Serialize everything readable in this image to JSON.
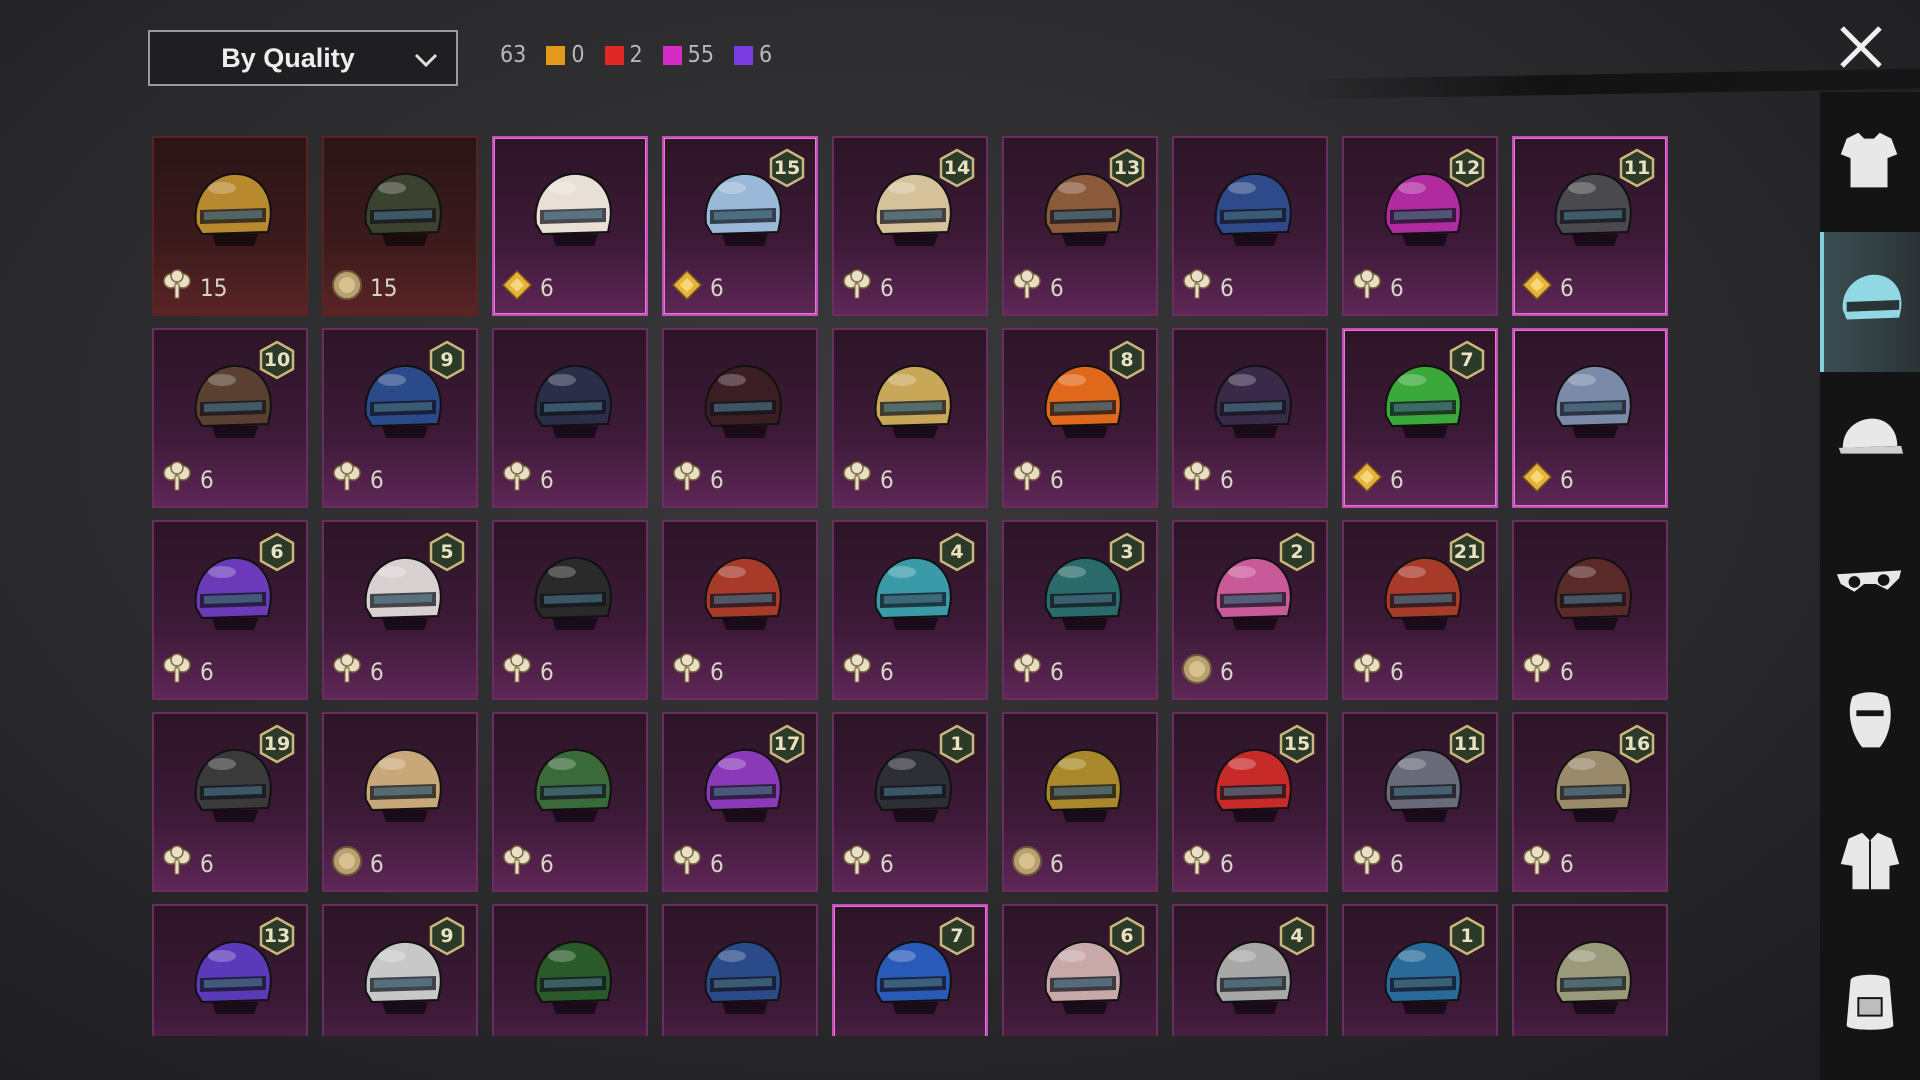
{
  "toolbar": {
    "sort_label": "By Quality",
    "total_count": "63",
    "counts": [
      {
        "color": "#e39a1c",
        "value": "0"
      },
      {
        "color": "#e02828",
        "value": "2"
      },
      {
        "color": "#d42cc4",
        "value": "55"
      },
      {
        "color": "#7a3ee0",
        "value": "6"
      }
    ],
    "close_icon": "close-icon"
  },
  "items": [
    {
      "level": "",
      "cost": "15",
      "currency": "clover",
      "rarity": "legendary",
      "color": "#b8892e"
    },
    {
      "level": "",
      "cost": "15",
      "currency": "coin",
      "rarity": "legendary",
      "color": "#3b4230"
    },
    {
      "level": "",
      "cost": "6",
      "currency": "diamond",
      "rarity": "mythic",
      "color": "#e8e0d6",
      "selected": true
    },
    {
      "level": "15",
      "cost": "6",
      "currency": "diamond",
      "rarity": "mythic",
      "color": "#9ab8d8",
      "selected": true
    },
    {
      "level": "14",
      "cost": "6",
      "currency": "clover",
      "rarity": "mythic",
      "color": "#d6c29a"
    },
    {
      "level": "13",
      "cost": "6",
      "currency": "clover",
      "rarity": "mythic",
      "color": "#8a5a3a"
    },
    {
      "level": "",
      "cost": "6",
      "currency": "clover",
      "rarity": "mythic",
      "color": "#2f4a8a"
    },
    {
      "level": "12",
      "cost": "6",
      "currency": "clover",
      "rarity": "mythic",
      "color": "#b02aa0"
    },
    {
      "level": "11",
      "cost": "6",
      "currency": "diamond",
      "rarity": "mythic",
      "color": "#4a4a4e",
      "selected": true
    },
    {
      "level": "10",
      "cost": "6",
      "currency": "clover",
      "rarity": "mythic",
      "color": "#5a4030"
    },
    {
      "level": "9",
      "cost": "6",
      "currency": "clover",
      "rarity": "mythic",
      "color": "#2a4a8a"
    },
    {
      "level": "",
      "cost": "6",
      "currency": "clover",
      "rarity": "mythic",
      "color": "#2a2e48"
    },
    {
      "level": "",
      "cost": "6",
      "currency": "clover",
      "rarity": "mythic",
      "color": "#3a1e24"
    },
    {
      "level": "",
      "cost": "6",
      "currency": "clover",
      "rarity": "mythic",
      "color": "#c8a858"
    },
    {
      "level": "8",
      "cost": "6",
      "currency": "clover",
      "rarity": "mythic",
      "color": "#e0681a"
    },
    {
      "level": "",
      "cost": "6",
      "currency": "clover",
      "rarity": "mythic",
      "color": "#3a2a4a"
    },
    {
      "level": "7",
      "cost": "6",
      "currency": "diamond",
      "rarity": "mythic",
      "color": "#3aa83a",
      "selected": true
    },
    {
      "level": "",
      "cost": "6",
      "currency": "diamond",
      "rarity": "mythic",
      "color": "#7a8aa8",
      "selected": true
    },
    {
      "level": "6",
      "cost": "6",
      "currency": "clover",
      "rarity": "mythic",
      "color": "#6a3ab8"
    },
    {
      "level": "5",
      "cost": "6",
      "currency": "clover",
      "rarity": "mythic",
      "color": "#d8d0d0"
    },
    {
      "level": "",
      "cost": "6",
      "currency": "clover",
      "rarity": "mythic",
      "color": "#2a2a2a"
    },
    {
      "level": "",
      "cost": "6",
      "currency": "clover",
      "rarity": "mythic",
      "color": "#a83a2a"
    },
    {
      "level": "4",
      "cost": "6",
      "currency": "clover",
      "rarity": "mythic",
      "color": "#3a9aa8"
    },
    {
      "level": "3",
      "cost": "6",
      "currency": "clover",
      "rarity": "mythic",
      "color": "#2a6a6a"
    },
    {
      "level": "2",
      "cost": "6",
      "currency": "coin",
      "rarity": "mythic",
      "color": "#c85a9a"
    },
    {
      "level": "21",
      "cost": "6",
      "currency": "clover",
      "rarity": "mythic",
      "color": "#a83a2a"
    },
    {
      "level": "",
      "cost": "6",
      "currency": "clover",
      "rarity": "mythic",
      "color": "#5a2a2a"
    },
    {
      "level": "19",
      "cost": "6",
      "currency": "clover",
      "rarity": "mythic",
      "color": "#3a3a3a"
    },
    {
      "level": "",
      "cost": "6",
      "currency": "coin",
      "rarity": "mythic",
      "color": "#c8a878"
    },
    {
      "level": "",
      "cost": "6",
      "currency": "clover",
      "rarity": "mythic",
      "color": "#3a6a3a"
    },
    {
      "level": "17",
      "cost": "6",
      "currency": "clover",
      "rarity": "mythic",
      "color": "#8a3ab8"
    },
    {
      "level": "1",
      "cost": "6",
      "currency": "clover",
      "rarity": "mythic",
      "color": "#2e2e36"
    },
    {
      "level": "",
      "cost": "6",
      "currency": "coin",
      "rarity": "mythic",
      "color": "#a8882a"
    },
    {
      "level": "15",
      "cost": "6",
      "currency": "clover",
      "rarity": "mythic",
      "color": "#c82a2a"
    },
    {
      "level": "11",
      "cost": "6",
      "currency": "clover",
      "rarity": "mythic",
      "color": "#6a6a7a"
    },
    {
      "level": "16",
      "cost": "6",
      "currency": "clover",
      "rarity": "mythic",
      "color": "#9a8a6a"
    },
    {
      "level": "13",
      "cost": "",
      "currency": "",
      "rarity": "mythic",
      "color": "#5a3ab8"
    },
    {
      "level": "9",
      "cost": "",
      "currency": "",
      "rarity": "mythic",
      "color": "#c8c8c8"
    },
    {
      "level": "",
      "cost": "",
      "currency": "",
      "rarity": "mythic",
      "color": "#2a5a2a"
    },
    {
      "level": "",
      "cost": "",
      "currency": "",
      "rarity": "mythic",
      "color": "#2a4a8a"
    },
    {
      "level": "7",
      "cost": "",
      "currency": "",
      "rarity": "mythic",
      "color": "#2a5ab8",
      "selected": true
    },
    {
      "level": "6",
      "cost": "",
      "currency": "",
      "rarity": "mythic",
      "color": "#c8a8a8"
    },
    {
      "level": "4",
      "cost": "",
      "currency": "",
      "rarity": "mythic",
      "color": "#a8a8a8"
    },
    {
      "level": "1",
      "cost": "",
      "currency": "",
      "rarity": "mythic",
      "color": "#2a6a9a"
    },
    {
      "level": "",
      "cost": "",
      "currency": "",
      "rarity": "mythic",
      "color": "#9a9a7a"
    }
  ],
  "sidebar": [
    {
      "name": "outfit-tab",
      "icon": "shirt-icon",
      "active": false
    },
    {
      "name": "helmet-tab",
      "icon": "helmet-icon",
      "active": true
    },
    {
      "name": "hat-tab",
      "icon": "cap-icon",
      "active": false
    },
    {
      "name": "eyewear-tab",
      "icon": "glasses-icon",
      "active": false
    },
    {
      "name": "mask-tab",
      "icon": "mask-icon",
      "active": false
    },
    {
      "name": "top-tab",
      "icon": "jacket-icon",
      "active": false
    },
    {
      "name": "backpack-tab",
      "icon": "backpack-icon",
      "active": false
    }
  ]
}
